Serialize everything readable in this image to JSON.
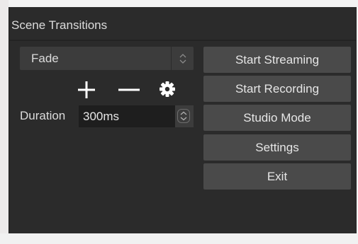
{
  "panel": {
    "title": "Scene Transitions"
  },
  "transition": {
    "selected": "Fade",
    "options": [
      "Fade"
    ]
  },
  "toolbar": {
    "add_icon": "plus-icon",
    "remove_icon": "minus-icon",
    "properties_icon": "gear-icon"
  },
  "duration": {
    "label": "Duration",
    "value": "300ms"
  },
  "controls": {
    "start_streaming": "Start Streaming",
    "start_recording": "Start Recording",
    "studio_mode": "Studio Mode",
    "settings": "Settings",
    "exit": "Exit"
  },
  "colors": {
    "panel_bg": "#2b2b2b",
    "button_bg": "#4a4a4a",
    "combo_bg": "#3c3c3c",
    "input_bg": "#1e1e1e",
    "text": "#dcdcdc"
  }
}
